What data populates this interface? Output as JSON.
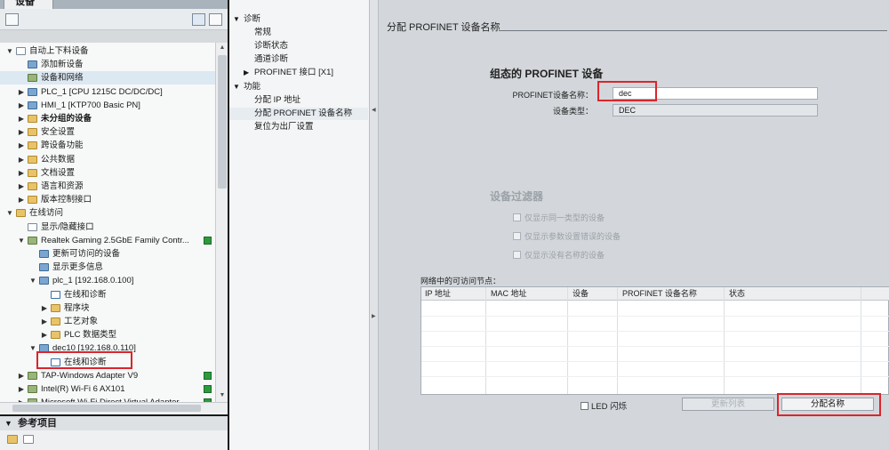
{
  "project_panel": {
    "tab_label": "设备",
    "tree": [
      {
        "label": "自动上下料设备",
        "arrow": "▼",
        "icon": "doc",
        "level": 0
      },
      {
        "label": "添加新设备",
        "arrow": "",
        "icon": "device",
        "level": 1
      },
      {
        "label": "设备和网络",
        "arrow": "",
        "icon": "net",
        "level": 1,
        "selected": true
      },
      {
        "label": "PLC_1 [CPU 1215C DC/DC/DC]",
        "arrow": "▶",
        "icon": "device",
        "level": 1
      },
      {
        "label": "HMI_1 [KTP700 Basic PN]",
        "arrow": "▶",
        "icon": "device",
        "level": 1
      },
      {
        "label": "未分组的设备",
        "arrow": "▶",
        "icon": "folder",
        "level": 1,
        "bold": true
      },
      {
        "label": "安全设置",
        "arrow": "▶",
        "icon": "folder",
        "level": 1
      },
      {
        "label": "跨设备功能",
        "arrow": "▶",
        "icon": "folder",
        "level": 1
      },
      {
        "label": "公共数据",
        "arrow": "▶",
        "icon": "folder",
        "level": 1
      },
      {
        "label": "文档设置",
        "arrow": "▶",
        "icon": "folder",
        "level": 1
      },
      {
        "label": "语言和资源",
        "arrow": "▶",
        "icon": "folder",
        "level": 1
      },
      {
        "label": "版本控制接口",
        "arrow": "▶",
        "icon": "folder",
        "level": 1
      },
      {
        "label": "在线访问",
        "arrow": "▼",
        "icon": "folder",
        "level": 0
      },
      {
        "label": "显示/隐藏接口",
        "arrow": "",
        "icon": "doc",
        "level": 1
      },
      {
        "label": "Realtek Gaming 2.5GbE Family Contr...",
        "arrow": "▼",
        "icon": "net",
        "level": 1,
        "flag": true
      },
      {
        "label": "更新可访问的设备",
        "arrow": "",
        "icon": "device",
        "level": 2
      },
      {
        "label": "显示更多信息",
        "arrow": "",
        "icon": "device",
        "level": 2
      },
      {
        "label": "plc_1 [192.168.0.100]",
        "arrow": "▼",
        "icon": "device",
        "level": 2
      },
      {
        "label": "在线和诊断",
        "arrow": "",
        "icon": "diag",
        "level": 3
      },
      {
        "label": "程序块",
        "arrow": "▶",
        "icon": "folder",
        "level": 3
      },
      {
        "label": "工艺对象",
        "arrow": "▶",
        "icon": "folder",
        "level": 3
      },
      {
        "label": "PLC 数据类型",
        "arrow": "▶",
        "icon": "folder",
        "level": 3
      },
      {
        "label": "dec10 [192.168.0.110]",
        "arrow": "▼",
        "icon": "device",
        "level": 2
      },
      {
        "label": "在线和诊断",
        "arrow": "",
        "icon": "diag",
        "level": 3
      },
      {
        "label": "TAP-Windows Adapter V9",
        "arrow": "▶",
        "icon": "net",
        "level": 1,
        "flag": true
      },
      {
        "label": "Intel(R) Wi-Fi 6 AX101",
        "arrow": "▶",
        "icon": "net",
        "level": 1,
        "flag": true
      },
      {
        "label": "Microsoft Wi-Fi Direct Virtual Adapter...",
        "arrow": "▶",
        "icon": "net",
        "level": 1,
        "flag": true
      }
    ],
    "reference_header": "参考项目"
  },
  "nav": {
    "items": [
      {
        "label": "诊断",
        "arrow": "▼",
        "level": 0
      },
      {
        "label": "常规",
        "arrow": "",
        "level": 1
      },
      {
        "label": "诊断状态",
        "arrow": "",
        "level": 1
      },
      {
        "label": "通道诊断",
        "arrow": "",
        "level": 1
      },
      {
        "label": "PROFINET 接口 [X1]",
        "arrow": "▶",
        "level": 1
      },
      {
        "label": "功能",
        "arrow": "▼",
        "level": 0
      },
      {
        "label": "分配 IP 地址",
        "arrow": "",
        "level": 1
      },
      {
        "label": "分配 PROFINET 设备名称",
        "arrow": "",
        "level": 1,
        "selected": true
      },
      {
        "label": "复位为出厂设置",
        "arrow": "",
        "level": 1
      }
    ]
  },
  "content": {
    "title": "分配 PROFINET 设备名称",
    "config_section": "组态的 PROFINET 设备",
    "device_name_label": "PROFINET设备名称",
    "device_name_value": "dec",
    "device_type_label": "设备类型",
    "device_type_value": "DEC",
    "filter_title": "设备过滤器",
    "filters": [
      "仅显示同一类型的设备",
      "仅显示参数设置错误的设备",
      "仅显示没有名称的设备"
    ],
    "nodes_label": "网络中的可访问节点：",
    "columns": [
      "IP 地址",
      "MAC 地址",
      "设备",
      "PROFINET 设备名称",
      "状态"
    ],
    "led_label": "LED 闪烁",
    "refresh_button": "更新列表",
    "assign_button": "分配名称"
  },
  "colors": {
    "highlight_red": "#d9262c",
    "status_green": "#2d9a3d"
  }
}
